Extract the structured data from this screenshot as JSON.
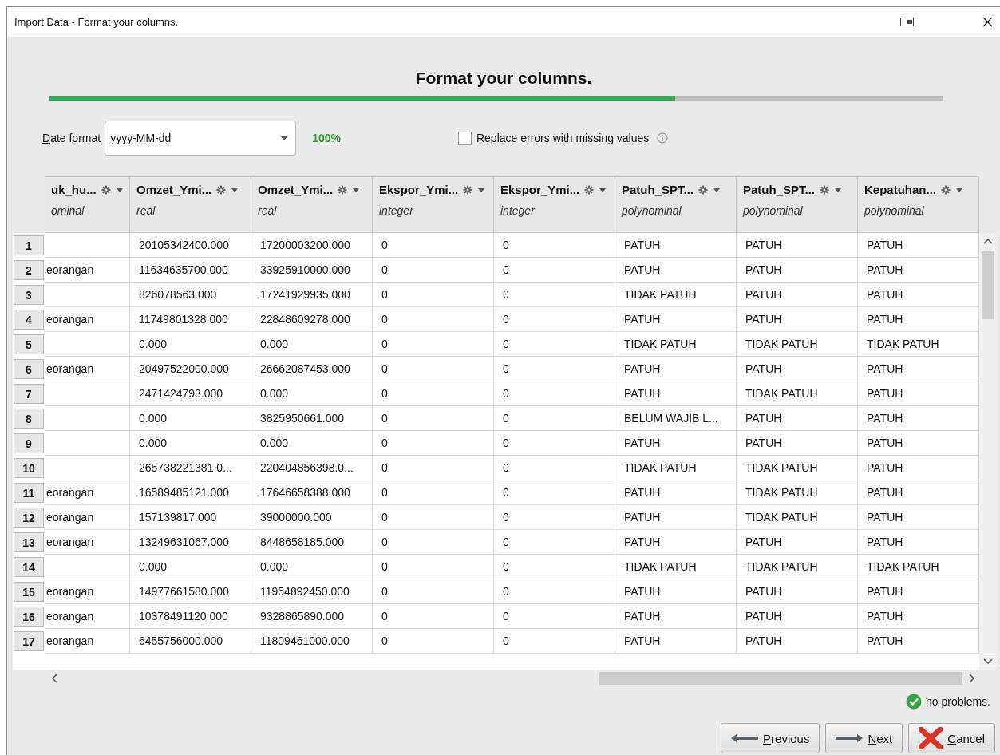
{
  "window": {
    "title": "Import Data - Format your columns."
  },
  "heading": "Format your columns.",
  "progress": {
    "level": 0.7
  },
  "date_format": {
    "label": "Date format",
    "value": "yyyy-MM-dd"
  },
  "date_match": "100%",
  "replace_errors": {
    "label": "Replace errors with missing values",
    "checked": false
  },
  "table": {
    "columns": [
      {
        "name": "uk_hu...",
        "type": "ominal"
      },
      {
        "name": "Omzet_Ymi...",
        "type": "real"
      },
      {
        "name": "Omzet_Ymi...",
        "type": "real"
      },
      {
        "name": "Ekspor_Ymi...",
        "type": "integer"
      },
      {
        "name": "Ekspor_Ymi...",
        "type": "integer"
      },
      {
        "name": "Patuh_SPT...",
        "type": "polynominal"
      },
      {
        "name": "Patuh_SPT...",
        "type": "polynominal"
      },
      {
        "name": "Kepatuhan...",
        "type": "polynominal"
      }
    ],
    "rows": [
      {
        "number": "1",
        "cells": [
          null,
          "20105342400.000",
          "17200003200.000",
          "0",
          "0",
          "PATUH",
          "PATUH",
          "PATUH"
        ]
      },
      {
        "number": "2",
        "cells": [
          "eorangan",
          "11634635700.000",
          "33925910000.000",
          "0",
          "0",
          "PATUH",
          "PATUH",
          "PATUH"
        ]
      },
      {
        "number": "3",
        "cells": [
          null,
          "826078563.000",
          "17241929935.000",
          "0",
          "0",
          "TIDAK PATUH",
          "PATUH",
          "PATUH"
        ]
      },
      {
        "number": "4",
        "cells": [
          "eorangan",
          "11749801328.000",
          "22848609278.000",
          "0",
          "0",
          "PATUH",
          "PATUH",
          "PATUH"
        ]
      },
      {
        "number": "5",
        "cells": [
          null,
          "0.000",
          "0.000",
          "0",
          "0",
          "TIDAK PATUH",
          "TIDAK PATUH",
          "TIDAK PATUH"
        ]
      },
      {
        "number": "6",
        "cells": [
          "eorangan",
          "20497522000.000",
          "26662087453.000",
          "0",
          "0",
          "PATUH",
          "PATUH",
          "PATUH"
        ]
      },
      {
        "number": "7",
        "cells": [
          null,
          "2471424793.000",
          "0.000",
          "0",
          "0",
          "PATUH",
          "TIDAK PATUH",
          "PATUH"
        ]
      },
      {
        "number": "8",
        "cells": [
          null,
          "0.000",
          "3825950661.000",
          "0",
          "0",
          "BELUM WAJIB L...",
          "PATUH",
          "PATUH"
        ]
      },
      {
        "number": "9",
        "cells": [
          null,
          "0.000",
          "0.000",
          "0",
          "0",
          "PATUH",
          "PATUH",
          "PATUH"
        ]
      },
      {
        "number": "10",
        "cells": [
          null,
          "265738221381.0...",
          "220404856398.0...",
          "0",
          "0",
          "TIDAK PATUH",
          "TIDAK PATUH",
          "PATUH"
        ]
      },
      {
        "number": "11",
        "cells": [
          "eorangan",
          "16589485121.000",
          "17646658388.000",
          "0",
          "0",
          "PATUH",
          "TIDAK PATUH",
          "PATUH"
        ]
      },
      {
        "number": "12",
        "cells": [
          "eorangan",
          "157139817.000",
          "39000000.000",
          "0",
          "0",
          "PATUH",
          "TIDAK PATUH",
          "PATUH"
        ]
      },
      {
        "number": "13",
        "cells": [
          "eorangan",
          "13249631067.000",
          "8448658185.000",
          "0",
          "0",
          "PATUH",
          "PATUH",
          "PATUH"
        ]
      },
      {
        "number": "14",
        "cells": [
          null,
          "0.000",
          "0.000",
          "0",
          "0",
          "TIDAK PATUH",
          "TIDAK PATUH",
          "TIDAK PATUH"
        ]
      },
      {
        "number": "15",
        "cells": [
          "eorangan",
          "14977661580.000",
          "11954892450.000",
          "0",
          "0",
          "PATUH",
          "PATUH",
          "PATUH"
        ]
      },
      {
        "number": "16",
        "cells": [
          "eorangan",
          "10378491120.000",
          "9328865890.000",
          "0",
          "0",
          "PATUH",
          "PATUH",
          "PATUH"
        ]
      },
      {
        "number": "17",
        "cells": [
          "eorangan",
          "6455756000.000",
          "11809461000.000",
          "0",
          "0",
          "PATUH",
          "PATUH",
          "PATUH"
        ]
      }
    ]
  },
  "status": "no problems.",
  "buttons": [
    {
      "label": "Previous",
      "kind": "previous"
    },
    {
      "label": "Next",
      "kind": "next"
    },
    {
      "label": "Cancel",
      "kind": "cancel"
    }
  ]
}
